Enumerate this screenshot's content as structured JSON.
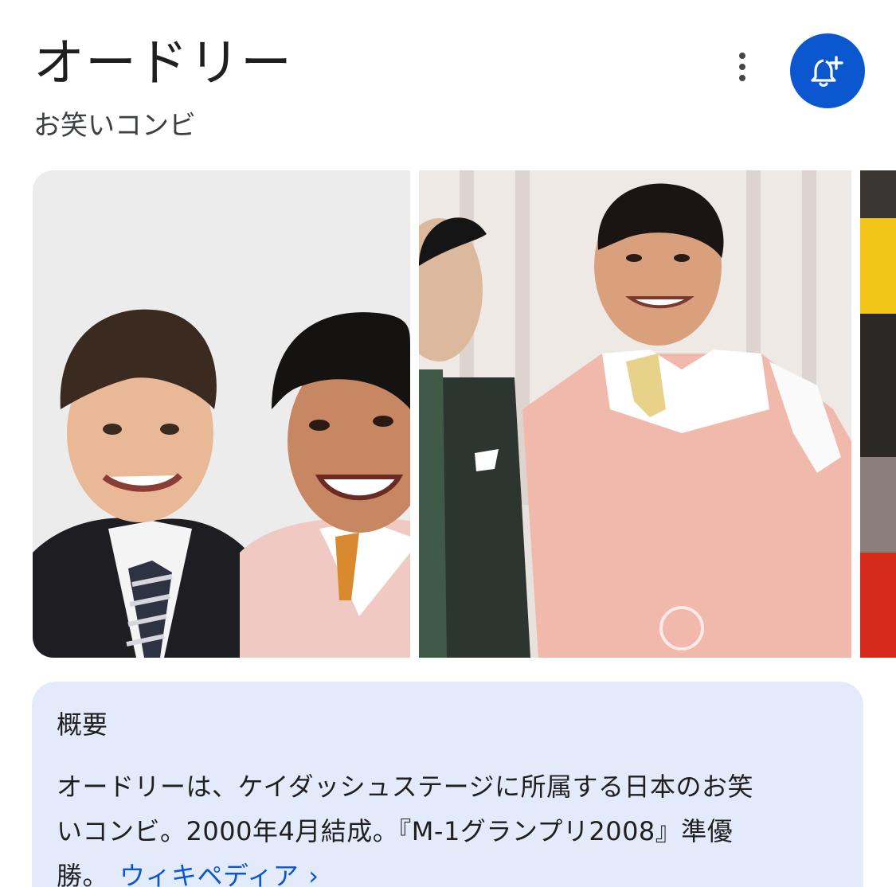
{
  "entity": {
    "title": "オードリー",
    "subtitle": "お笑いコンビ"
  },
  "actions": {
    "more_icon": "more-vert-icon",
    "follow_icon": "bell-plus-icon",
    "accent_color": "#0b57d0"
  },
  "gallery": {
    "images": [
      {
        "description_icon": "photo-duo-portrait"
      },
      {
        "description_icon": "photo-stage-pink-vest"
      },
      {
        "description_icon": "photo-partial"
      }
    ]
  },
  "summary": {
    "heading": "概要",
    "line1": "オードリーは、ケイダッシュステージに所属する日本のお笑",
    "line2": "いコンビ。2000年4月結成。『M-1グランプリ2008』準優",
    "line3": "勝。",
    "link_label": "ウィキペディア",
    "link_chevron": "›",
    "background_color": "#e3ebfb"
  }
}
